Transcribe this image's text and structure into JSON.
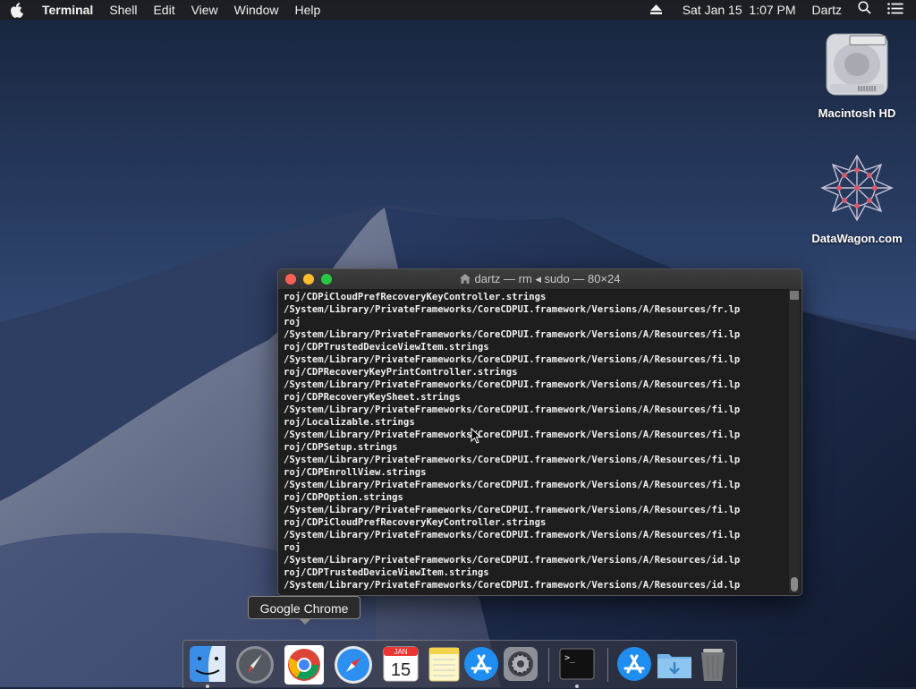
{
  "menubar": {
    "app_name": "Terminal",
    "menus": [
      "Shell",
      "Edit",
      "View",
      "Window",
      "Help"
    ],
    "clock": "Sat Jan 15  1:07 PM",
    "user": "Dartz"
  },
  "desktop": {
    "icons": [
      {
        "label": "Macintosh HD"
      },
      {
        "label": "DataWagon.com"
      }
    ]
  },
  "terminal": {
    "title": "dartz — rm ◂ sudo — 80×24",
    "lines": [
      "roj/CDPiCloudPrefRecoveryKeyController.strings",
      "/System/Library/PrivateFrameworks/CoreCDPUI.framework/Versions/A/Resources/fr.lp",
      "roj",
      "/System/Library/PrivateFrameworks/CoreCDPUI.framework/Versions/A/Resources/fi.lp",
      "roj/CDPTrustedDeviceViewItem.strings",
      "/System/Library/PrivateFrameworks/CoreCDPUI.framework/Versions/A/Resources/fi.lp",
      "roj/CDPRecoveryKeyPrintController.strings",
      "/System/Library/PrivateFrameworks/CoreCDPUI.framework/Versions/A/Resources/fi.lp",
      "roj/CDPRecoveryKeySheet.strings",
      "/System/Library/PrivateFrameworks/CoreCDPUI.framework/Versions/A/Resources/fi.lp",
      "roj/Localizable.strings",
      "/System/Library/PrivateFrameworks/CoreCDPUI.framework/Versions/A/Resources/fi.lp",
      "roj/CDPSetup.strings",
      "/System/Library/PrivateFrameworks/CoreCDPUI.framework/Versions/A/Resources/fi.lp",
      "roj/CDPEnrollView.strings",
      "/System/Library/PrivateFrameworks/CoreCDPUI.framework/Versions/A/Resources/fi.lp",
      "roj/CDPOption.strings",
      "/System/Library/PrivateFrameworks/CoreCDPUI.framework/Versions/A/Resources/fi.lp",
      "roj/CDPiCloudPrefRecoveryKeyController.strings",
      "/System/Library/PrivateFrameworks/CoreCDPUI.framework/Versions/A/Resources/fi.lp",
      "roj",
      "/System/Library/PrivateFrameworks/CoreCDPUI.framework/Versions/A/Resources/id.lp",
      "roj/CDPTrustedDeviceViewItem.strings",
      "/System/Library/PrivateFrameworks/CoreCDPUI.framework/Versions/A/Resources/id.lp"
    ]
  },
  "tooltip": "Google Chrome",
  "dock": {
    "calendar_month": "JAN",
    "calendar_day": "15",
    "terminal_prompt": ">_",
    "items": [
      "finder-icon",
      "launchpad-icon",
      "chrome-icon",
      "safari-icon",
      "calendar-icon",
      "notes-icon",
      "app-store-icon",
      "system-preferences-icon",
      "terminal-icon",
      "app-store-downloads-icon",
      "downloads-folder-icon",
      "trash-icon"
    ]
  }
}
